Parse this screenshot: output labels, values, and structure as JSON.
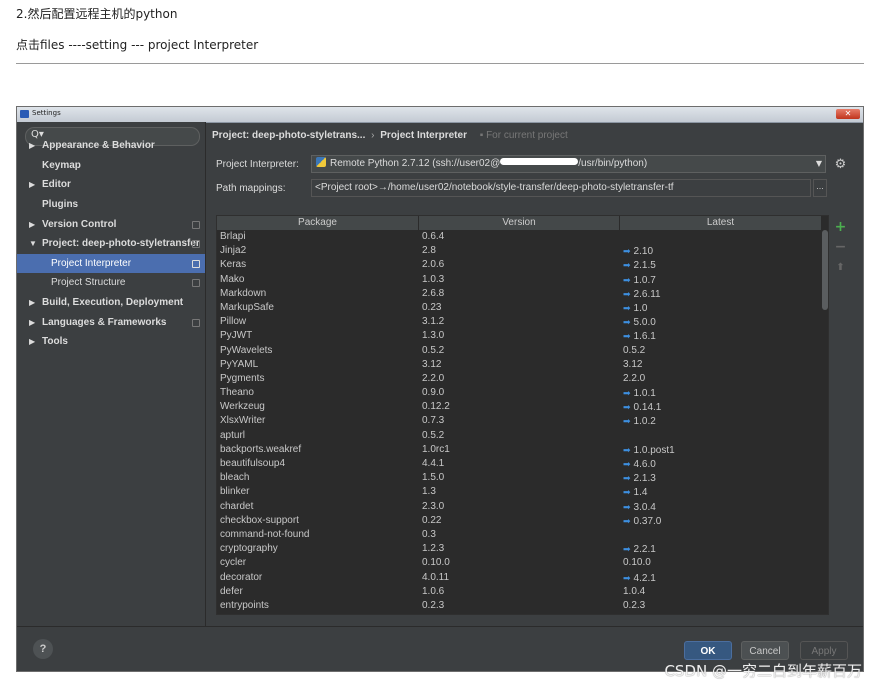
{
  "blog": {
    "step_text": "2.然后配置远程主机的python",
    "nav_text": "点击files ----setting --- project Interpreter"
  },
  "window": {
    "title": "Settings",
    "close_glyph": "✕"
  },
  "sidebar": {
    "search_glyph": "Q▾",
    "items": [
      {
        "label": "Appearance & Behavior",
        "arrow": "▶"
      },
      {
        "label": "Keymap",
        "arrow": ""
      },
      {
        "label": "Editor",
        "arrow": "▶"
      },
      {
        "label": "Plugins",
        "arrow": ""
      },
      {
        "label": "Version Control",
        "arrow": "▶"
      },
      {
        "label": "Project: deep-photo-styletransfer",
        "arrow": "▼"
      },
      {
        "label": "Project Interpreter",
        "arrow": ""
      },
      {
        "label": "Project Structure",
        "arrow": ""
      },
      {
        "label": "Build, Execution, Deployment",
        "arrow": "▶"
      },
      {
        "label": "Languages & Frameworks",
        "arrow": "▶"
      },
      {
        "label": "Tools",
        "arrow": "▶"
      }
    ]
  },
  "breadcrumb": {
    "project": "Project: deep-photo-styletrans...",
    "separator": "›",
    "page": "Project Interpreter",
    "hint": "For current project"
  },
  "interpreter": {
    "label": "Project Interpreter:",
    "value_prefix": "Remote Python 2.7.12 (ssh://user02@",
    "value_suffix": "/usr/bin/python)",
    "dropdown_glyph": "▼",
    "gear_glyph": "⚙"
  },
  "path_mappings": {
    "label": "Path mappings:",
    "value": "<Project root>→/home/user02/notebook/style-transfer/deep-photo-styletransfer-tf",
    "button": "..."
  },
  "table": {
    "headers": [
      "Package",
      "Version",
      "Latest"
    ],
    "upgrade_glyph": "➡",
    "rows": [
      {
        "package": "Brlapi",
        "version": "0.6.4",
        "latest": "",
        "upgrade": false
      },
      {
        "package": "Jinja2",
        "version": "2.8",
        "latest": "2.10",
        "upgrade": true
      },
      {
        "package": "Keras",
        "version": "2.0.6",
        "latest": "2.1.5",
        "upgrade": true
      },
      {
        "package": "Mako",
        "version": "1.0.3",
        "latest": "1.0.7",
        "upgrade": true
      },
      {
        "package": "Markdown",
        "version": "2.6.8",
        "latest": "2.6.11",
        "upgrade": true
      },
      {
        "package": "MarkupSafe",
        "version": "0.23",
        "latest": "1.0",
        "upgrade": true
      },
      {
        "package": "Pillow",
        "version": "3.1.2",
        "latest": "5.0.0",
        "upgrade": true
      },
      {
        "package": "PyJWT",
        "version": "1.3.0",
        "latest": "1.6.1",
        "upgrade": true
      },
      {
        "package": "PyWavelets",
        "version": "0.5.2",
        "latest": "0.5.2",
        "upgrade": false
      },
      {
        "package": "PyYAML",
        "version": "3.12",
        "latest": "3.12",
        "upgrade": false
      },
      {
        "package": "Pygments",
        "version": "2.2.0",
        "latest": "2.2.0",
        "upgrade": false
      },
      {
        "package": "Theano",
        "version": "0.9.0",
        "latest": "1.0.1",
        "upgrade": true
      },
      {
        "package": "Werkzeug",
        "version": "0.12.2",
        "latest": "0.14.1",
        "upgrade": true
      },
      {
        "package": "XlsxWriter",
        "version": "0.7.3",
        "latest": "1.0.2",
        "upgrade": true
      },
      {
        "package": "apturl",
        "version": "0.5.2",
        "latest": "",
        "upgrade": false
      },
      {
        "package": "backports.weakref",
        "version": "1.0rc1",
        "latest": "1.0.post1",
        "upgrade": true
      },
      {
        "package": "beautifulsoup4",
        "version": "4.4.1",
        "latest": "4.6.0",
        "upgrade": true
      },
      {
        "package": "bleach",
        "version": "1.5.0",
        "latest": "2.1.3",
        "upgrade": true
      },
      {
        "package": "blinker",
        "version": "1.3",
        "latest": "1.4",
        "upgrade": true
      },
      {
        "package": "chardet",
        "version": "2.3.0",
        "latest": "3.0.4",
        "upgrade": true
      },
      {
        "package": "checkbox-support",
        "version": "0.22",
        "latest": "0.37.0",
        "upgrade": true
      },
      {
        "package": "command-not-found",
        "version": "0.3",
        "latest": "",
        "upgrade": false
      },
      {
        "package": "cryptography",
        "version": "1.2.3",
        "latest": "2.2.1",
        "upgrade": true
      },
      {
        "package": "cycler",
        "version": "0.10.0",
        "latest": "0.10.0",
        "upgrade": false
      },
      {
        "package": "decorator",
        "version": "4.0.11",
        "latest": "4.2.1",
        "upgrade": true
      },
      {
        "package": "defer",
        "version": "1.0.6",
        "latest": "1.0.4",
        "upgrade": false
      },
      {
        "package": "entrypoints",
        "version": "0.2.3",
        "latest": "0.2.3",
        "upgrade": false
      }
    ]
  },
  "table_tools": {
    "add": "+",
    "remove": "−",
    "upgrade": "⬆"
  },
  "footer": {
    "help": "?",
    "ok": "OK",
    "cancel": "Cancel",
    "apply": "Apply"
  },
  "watermark": "CSDN @一穷二白到年薪百万",
  "colors": {
    "panel": "#3c3f41",
    "table_bg": "#2b2b2b",
    "selection": "#4b6eaf",
    "upgrade_arrow": "#3d8fe0",
    "add_green": "#4caf50"
  }
}
